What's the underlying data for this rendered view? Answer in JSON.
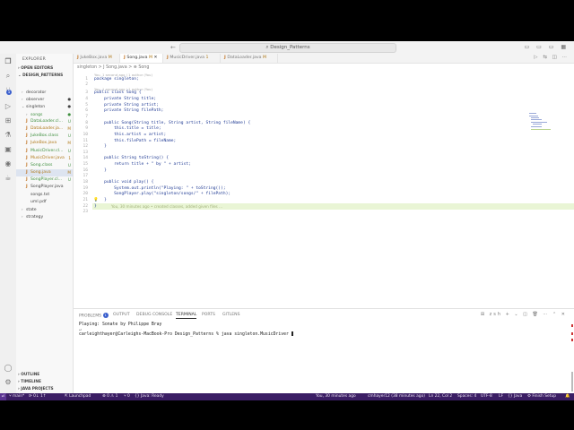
{
  "window": {
    "title": "Design_Patterns",
    "nav_back": "←",
    "nav_forward": "→"
  },
  "explorer": {
    "header": "EXPLORER",
    "open_editors": "OPEN EDITORS",
    "project": "DESIGN_PATTERNS",
    "tree": [
      {
        "label": "decorator",
        "kind": "folder",
        "depth": 1,
        "status": ""
      },
      {
        "label": "observer",
        "kind": "folder",
        "depth": 1,
        "status": "●"
      },
      {
        "label": "singleton",
        "kind": "folder-open",
        "depth": 1,
        "status": "●"
      },
      {
        "label": "songs",
        "kind": "folder",
        "depth": 2,
        "status": "●",
        "state": "unt"
      },
      {
        "label": "DataLoader.cl...",
        "kind": "java",
        "depth": 2,
        "status": "U",
        "state": "unt"
      },
      {
        "label": "DataLoader.ja...",
        "kind": "java",
        "depth": 2,
        "status": "M",
        "state": "mod"
      },
      {
        "label": "JukeBox.class",
        "kind": "java",
        "depth": 2,
        "status": "U",
        "state": "unt"
      },
      {
        "label": "JukeBox.java",
        "kind": "java",
        "depth": 2,
        "status": "M",
        "state": "mod"
      },
      {
        "label": "MusicDriver.cl...",
        "kind": "java",
        "depth": 2,
        "status": "U",
        "state": "unt"
      },
      {
        "label": "MusicDriver.java",
        "kind": "java",
        "depth": 2,
        "status": "1",
        "state": "mod"
      },
      {
        "label": "Song.class",
        "kind": "java",
        "depth": 2,
        "status": "U",
        "state": "unt"
      },
      {
        "label": "Song.java",
        "kind": "java",
        "depth": 2,
        "status": "M",
        "state": "mod",
        "selected": true
      },
      {
        "label": "SongPlayer.cl...",
        "kind": "java",
        "depth": 2,
        "status": "U",
        "state": "unt"
      },
      {
        "label": "SongPlayer.java",
        "kind": "java",
        "depth": 2,
        "status": "",
        "state": ""
      },
      {
        "label": "songs.txt",
        "kind": "file",
        "depth": 2,
        "status": "",
        "state": ""
      },
      {
        "label": "uml.pdf",
        "kind": "file",
        "depth": 2,
        "status": "",
        "state": ""
      },
      {
        "label": "state",
        "kind": "folder",
        "depth": 1,
        "status": ""
      },
      {
        "label": "strategy",
        "kind": "folder",
        "depth": 1,
        "status": ""
      }
    ],
    "outline": "OUTLINE",
    "timeline": "TIMELINE",
    "java_projects": "JAVA PROJECTS"
  },
  "tabs": [
    {
      "label": "JukeBox.java",
      "badge": "M",
      "active": false
    },
    {
      "label": "Song.java",
      "badge": "M",
      "active": true
    },
    {
      "label": "MusicDriver.java",
      "badge": "1",
      "active": false
    },
    {
      "label": "DataLoader.java",
      "badge": "M",
      "active": false
    }
  ],
  "breadcrumbs": "singleton  >  J Song.java  >  ⊕ Song",
  "code": {
    "lines": [
      {
        "n": "1",
        "text": "package singleton;",
        "lens": "You, 1 second ago | 1 author (You)"
      },
      {
        "n": "2",
        "text": ""
      },
      {
        "n": "3",
        "text": "public class Song {"
      },
      {
        "n": "4",
        "text": "    private String title;"
      },
      {
        "n": "5",
        "text": "    private String artist;"
      },
      {
        "n": "6",
        "text": "    private String filePath;"
      },
      {
        "n": "7",
        "text": ""
      },
      {
        "n": "8",
        "text": "    public Song(String title, String artist, String fileName) {"
      },
      {
        "n": "9",
        "text": "        this.title = title;"
      },
      {
        "n": "10",
        "text": "        this.artist = artist;"
      },
      {
        "n": "11",
        "text": "        this.filePath = fileName;"
      },
      {
        "n": "12",
        "text": "    }"
      },
      {
        "n": "13",
        "text": ""
      },
      {
        "n": "14",
        "text": "    public String toString() {"
      },
      {
        "n": "15",
        "text": "        return title + \" by \" + artist;"
      },
      {
        "n": "16",
        "text": "    }"
      },
      {
        "n": "17",
        "text": ""
      },
      {
        "n": "18",
        "text": "    public void play() {"
      },
      {
        "n": "19",
        "text": "        System.out.println(\"Playing: \" + toString());"
      },
      {
        "n": "20",
        "text": "        SongPlayer.play(\"singleton/songs/\" + filePath);"
      },
      {
        "n": "21",
        "text": "    }"
      },
      {
        "n": "22",
        "text": "}"
      },
      {
        "n": "23",
        "text": ""
      }
    ],
    "blame": "You, 30 minutes ago • created classes, added given files …"
  },
  "panel": {
    "tabs": [
      "PROBLEMS",
      "OUTPUT",
      "DEBUG CONSOLE",
      "TERMINAL",
      "PORTS",
      "GITLENS"
    ],
    "problems_count": "1",
    "shell": "zsh",
    "output": "Playing: Sonate by Philippe Bray",
    "prompt": "carleighthayer@Carleighs-MacBook-Pro Design_Patterns % java singleton.MusicDriver "
  },
  "statusbar": {
    "branch": "main*",
    "sync": "⟳ 0↓ 1↑",
    "launchpad": "Launchpad",
    "problems": "⊗ 0 ⚠ 1",
    "ports": "⑂ 0",
    "java": "{} Java: Ready",
    "blame": "You, 30 minutes ago",
    "author": "cmhayer12 (38 minutes ago)",
    "position": "Ln 22, Col 2",
    "spaces": "Spaces: 4",
    "encoding": "UTF-8",
    "eol": "LF",
    "language": "{} Java",
    "finish": "Finish Setup"
  }
}
